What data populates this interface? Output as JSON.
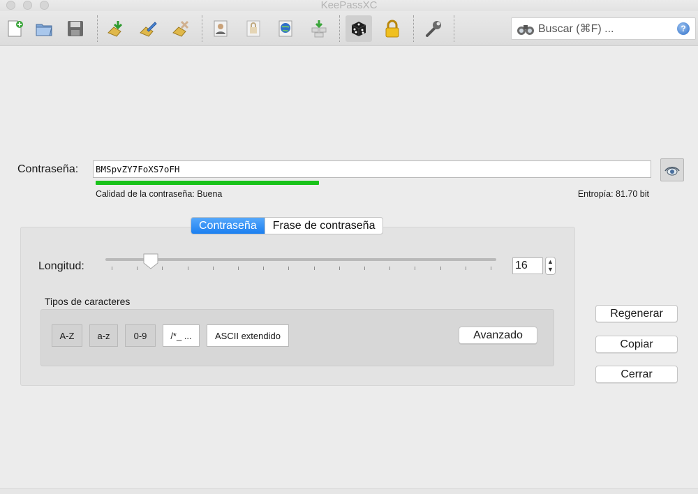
{
  "window": {
    "title": "KeePassXC"
  },
  "toolbar": {
    "buttons": [
      {
        "name": "new-database",
        "icon": "new-database-icon"
      },
      {
        "name": "open-database",
        "icon": "open-database-icon"
      },
      {
        "name": "save-database",
        "icon": "save-database-icon"
      },
      {
        "name": "add-entry",
        "icon": "add-entry-icon"
      },
      {
        "name": "edit-entry",
        "icon": "edit-entry-icon"
      },
      {
        "name": "delete-entry",
        "icon": "delete-entry-icon"
      },
      {
        "name": "copy-username",
        "icon": "copy-username-icon"
      },
      {
        "name": "copy-password",
        "icon": "copy-password-icon"
      },
      {
        "name": "copy-url",
        "icon": "copy-url-icon"
      },
      {
        "name": "autotype",
        "icon": "autotype-icon"
      },
      {
        "name": "password-generator",
        "icon": "dice-icon"
      },
      {
        "name": "lock-database",
        "icon": "lock-icon"
      },
      {
        "name": "settings",
        "icon": "wrench-icon"
      }
    ],
    "search": {
      "placeholder": "Buscar (⌘F) ..."
    }
  },
  "password": {
    "label": "Contraseña:",
    "value": "BMSpvZY7FoXS7oFH",
    "quality_label": "Calidad de la contraseña: Buena",
    "quality_fraction": 0.4,
    "entropy_label": "Entropía: 81.70 bit",
    "quality_color": "#19c21a"
  },
  "tabs": [
    {
      "label": "Contraseña",
      "selected": true
    },
    {
      "label": "Frase de contraseña",
      "selected": false
    }
  ],
  "length": {
    "label": "Longitud:",
    "value": "16",
    "slider_fraction": 0.11
  },
  "char_types": {
    "label": "Tipos de caracteres",
    "buttons": [
      {
        "label": "A-Z",
        "on": true
      },
      {
        "label": "a-z",
        "on": true
      },
      {
        "label": "0-9",
        "on": true
      },
      {
        "label": "/*_ ...",
        "on": false
      },
      {
        "label": "ASCII extendido",
        "on": false
      }
    ],
    "advanced_label": "Avanzado"
  },
  "actions": {
    "regenerate": "Regenerar",
    "copy": "Copiar",
    "close": "Cerrar"
  },
  "colors": {
    "accent": "#1b7ff0",
    "background": "#ececec"
  }
}
